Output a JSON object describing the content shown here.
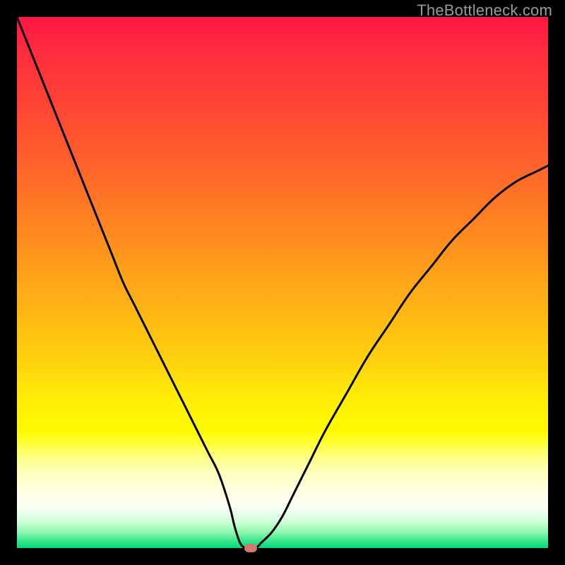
{
  "watermark": "TheBottleneck.com",
  "chart_data": {
    "type": "line",
    "title": "",
    "xlabel": "",
    "ylabel": "",
    "xlim": [
      0,
      100
    ],
    "ylim": [
      0,
      100
    ],
    "x": [
      0,
      2,
      4,
      6,
      8,
      10,
      12,
      14,
      16,
      18,
      20,
      22,
      24,
      26,
      28,
      30,
      32,
      34,
      36,
      38,
      40,
      41,
      42,
      43,
      44,
      45,
      46,
      48,
      50,
      52,
      55,
      58,
      62,
      66,
      70,
      74,
      78,
      82,
      86,
      90,
      94,
      98,
      100
    ],
    "values": [
      100,
      95,
      90,
      85,
      80,
      75,
      70,
      65,
      60,
      55,
      50,
      46,
      42,
      38,
      34,
      30,
      26,
      22,
      18,
      14,
      8,
      4,
      1,
      0,
      0,
      0,
      1,
      3,
      6,
      10,
      16,
      22,
      29,
      36,
      42,
      48,
      53,
      58,
      62,
      66,
      69,
      71,
      72
    ],
    "optimum_x": 44,
    "optimum_y": 0,
    "gradient_colors": [
      "#ff1744",
      "#ffd60d",
      "#fffff0",
      "#00d878"
    ]
  },
  "marker": {
    "color": "#d27a6f"
  }
}
